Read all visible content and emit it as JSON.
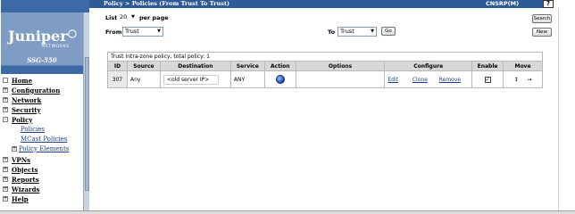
{
  "header": {
    "page_title": "Policy > Policies (From Trust To Trust)",
    "device_name": "CNSRP(M)",
    "help_label": "?"
  },
  "brand": {
    "logo_text": "Juniper",
    "logo_subtext": "NETWORKS",
    "model": "SSG-550",
    "colors": {
      "sidebar": "#3b6aa6",
      "brand_panel": "#7f9dc4",
      "titlebar": "#2e5a96"
    }
  },
  "sidebar": {
    "items": [
      {
        "label": "Home",
        "box": ""
      },
      {
        "label": "Configuration",
        "box": "+"
      },
      {
        "label": "Network",
        "box": "+"
      },
      {
        "label": "Security",
        "box": "+"
      },
      {
        "label": "Policy",
        "box": "-"
      },
      {
        "label": "VPNs",
        "box": "+"
      },
      {
        "label": "Objects",
        "box": "+"
      },
      {
        "label": "Reports",
        "box": "+"
      },
      {
        "label": "Wizards",
        "box": "+"
      },
      {
        "label": "Help",
        "box": "+"
      }
    ],
    "policy_children": [
      {
        "label": "Policies",
        "box": ""
      },
      {
        "label": "MCast Policies",
        "box": ""
      },
      {
        "label": "Policy Elements",
        "box": "+"
      }
    ]
  },
  "controls": {
    "list_label": "List",
    "per_page_value": "20",
    "per_page_label": "per page",
    "from_label": "From",
    "from_value": "Trust",
    "to_label": "To",
    "to_value": "Trust",
    "go_label": "Go",
    "search_label": "Search",
    "new_label": "New"
  },
  "table": {
    "caption": "Trust Intra-zone policy, total policy: 1",
    "columns": [
      "ID",
      "Source",
      "Destination",
      "Service",
      "Action",
      "Options",
      "Configure",
      "Enable",
      "Move"
    ],
    "rows": [
      {
        "id": "307",
        "source": "Any",
        "destination": "<old server IP>",
        "service": "ANY",
        "action_icon": "permit-globe-icon",
        "options": "",
        "edit": "Edit",
        "clone": "Clone",
        "remove": "Remove",
        "enabled": true,
        "move_up_down": "↕",
        "move_arrow": "➞"
      }
    ]
  }
}
